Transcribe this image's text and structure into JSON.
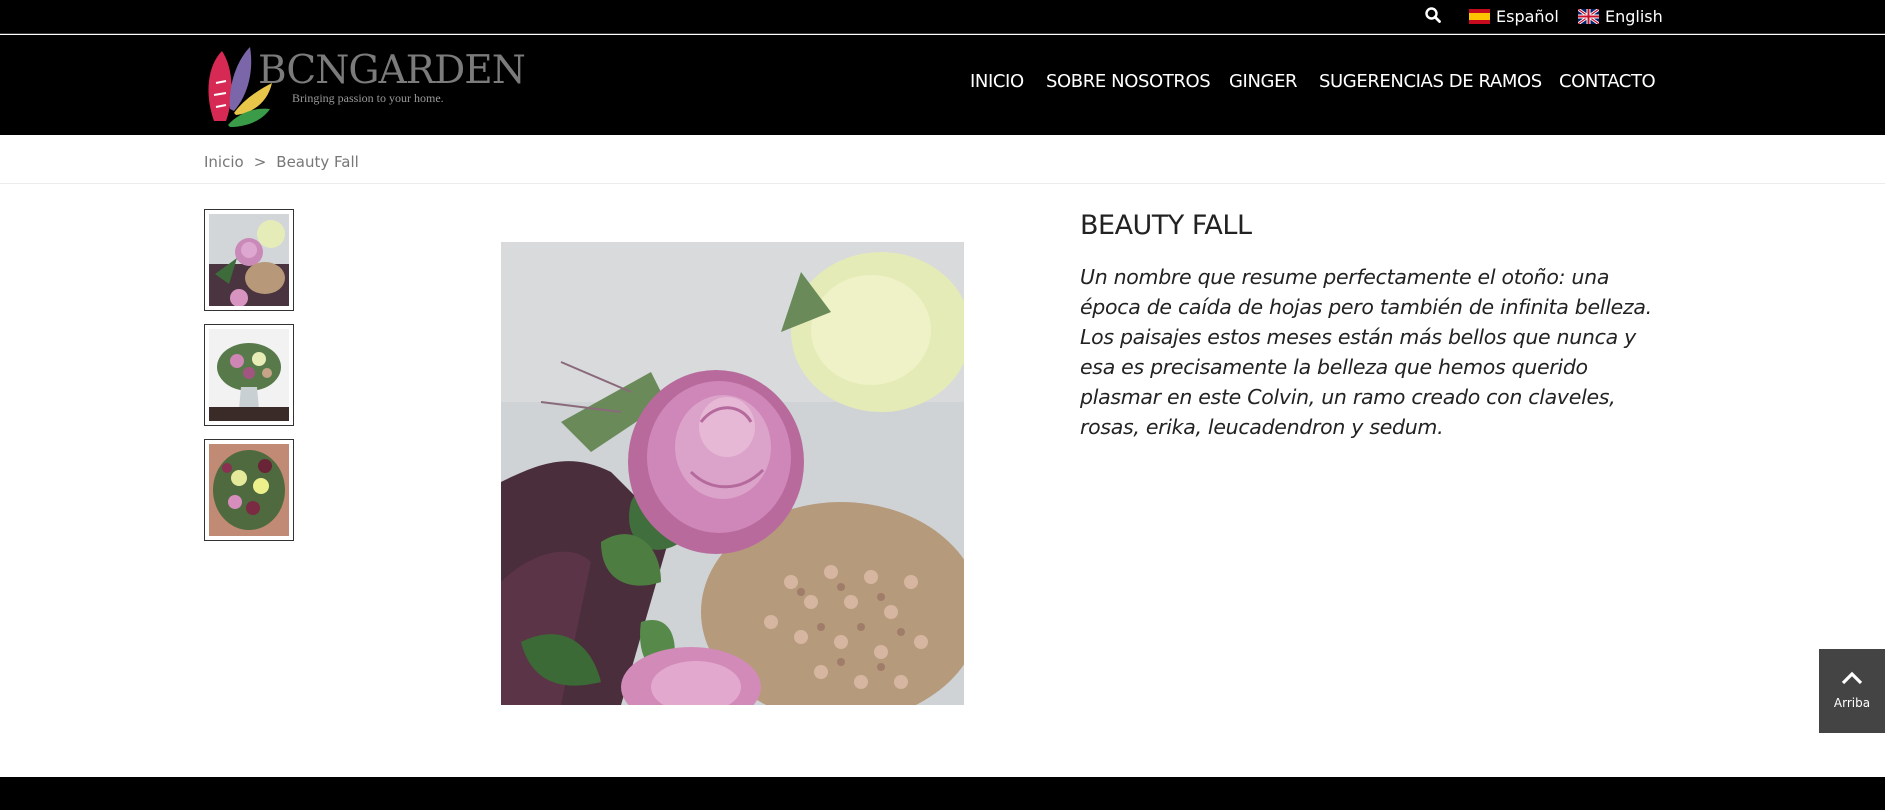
{
  "topbar": {
    "icons": {
      "search": "search-icon"
    },
    "languages": [
      {
        "label": "Español",
        "flag": "spain-flag-icon"
      },
      {
        "label": "English",
        "flag": "uk-flag-icon"
      }
    ]
  },
  "header": {
    "logo": {
      "name": "BCNGARDEN",
      "tagline": "Bringing passion to your home."
    },
    "nav": [
      "INICIO",
      "SOBRE NOSOTROS",
      "GINGER",
      "SUGERENCIAS DE RAMOS",
      "CONTACTO"
    ]
  },
  "breadcrumb": {
    "home": "Inicio",
    "separator": ">",
    "current": "Beauty Fall"
  },
  "product": {
    "title": "BEAUTY FALL",
    "description": "Un nombre que resume perfectamente el otoño: una época de caída de hojas pero también de infinita belleza. Los paisajes estos meses están más bellos que nunca y esa es precisamente la belleza que hemos querido plasmar en este Colvin, un ramo creado con claveles, rosas, erika, leucadendron y sedum."
  },
  "back_to_top": {
    "label": "Arriba",
    "icon": "chevron-up-icon"
  },
  "colors": {
    "bar": "#000000",
    "button": "#444444",
    "text": "#222222",
    "breadcrumb": "#777777"
  }
}
